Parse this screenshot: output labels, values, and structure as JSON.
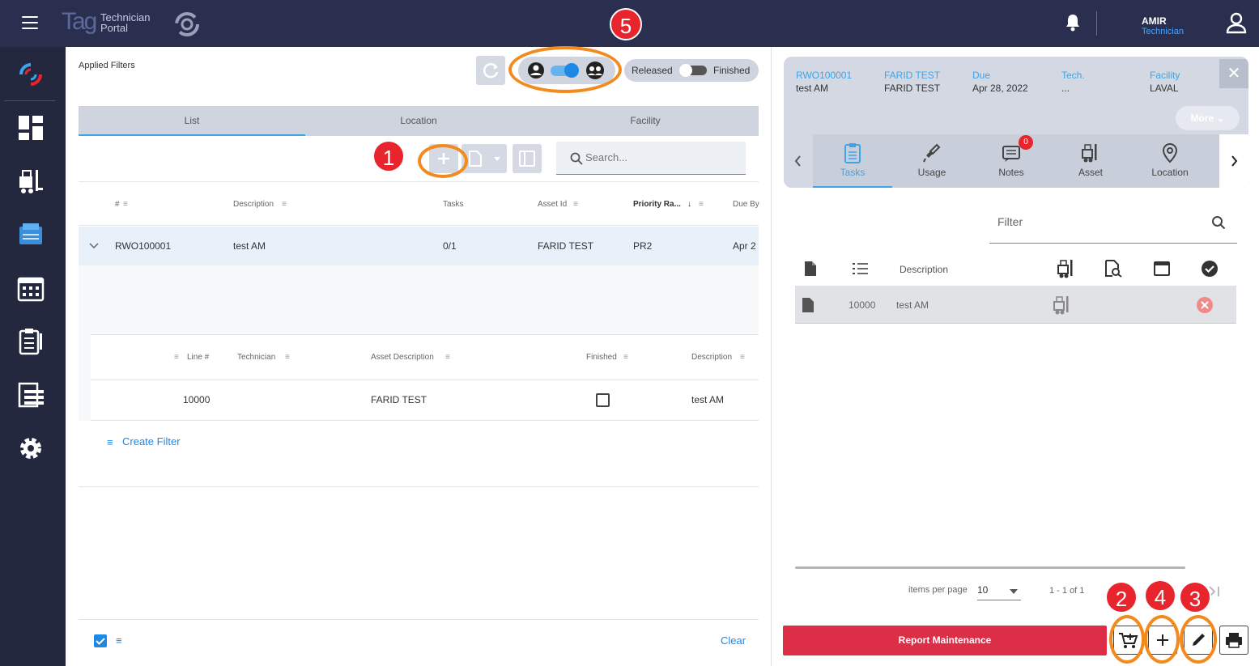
{
  "header": {
    "logo_tag": "Tag",
    "logo_sub_1": "Technician",
    "logo_sub_2": "Portal",
    "user_name": "AMIR",
    "user_role": "Technician"
  },
  "left": {
    "applied_filters": "Applied Filters",
    "released_label": "Released",
    "finished_label": "Finished",
    "tabs": [
      "List",
      "Location",
      "Facility"
    ],
    "search_placeholder": "Search...",
    "columns": {
      "num": "#",
      "description": "Description",
      "tasks": "Tasks",
      "asset_id": "Asset Id",
      "priority": "Priority Ra...",
      "due_by": "Due By"
    },
    "row": {
      "num": "RWO100001",
      "description": "test AM",
      "tasks": "0/1",
      "asset_id": "FARID TEST",
      "priority": "PR2",
      "due_by": "Apr 2"
    },
    "sub_columns": {
      "line": "Line #",
      "technician": "Technician",
      "asset_description": "Asset Description",
      "finished": "Finished",
      "description": "Description"
    },
    "sub_row": {
      "line": "10000",
      "technician": "",
      "asset_description": "FARID TEST",
      "description": "test AM"
    },
    "create_filter": "Create Filter",
    "clear": "Clear"
  },
  "right": {
    "summary": [
      {
        "label": "RWO100001",
        "value": "test AM"
      },
      {
        "label": "FARID TEST",
        "value": "FARID TEST"
      },
      {
        "label": "Due",
        "value": "Apr 28, 2022"
      },
      {
        "label": "Tech.",
        "value": "..."
      },
      {
        "label": "Facility",
        "value": "LAVAL"
      }
    ],
    "more": "More",
    "tabs": [
      {
        "label": "Tasks",
        "icon": "clipboard-icon"
      },
      {
        "label": "Usage",
        "icon": "spark-plug-icon"
      },
      {
        "label": "Notes",
        "icon": "notes-icon",
        "badge": "0"
      },
      {
        "label": "Asset",
        "icon": "forklift-icon"
      },
      {
        "label": "Location",
        "icon": "location-pin-icon"
      }
    ],
    "filter_label": "Filter",
    "task_head_description": "Description",
    "task_row": {
      "line": "10000",
      "description": "test AM"
    },
    "items_per_page_label": "items per page",
    "items_per_page": "10",
    "range": "1 - 1 of 1",
    "report_button": "Report Maintenance"
  },
  "annotations": [
    "1",
    "2",
    "3",
    "4",
    "5"
  ],
  "colors": {
    "topbar": "#2b2f4f",
    "sidebar": "#24283f",
    "accent": "#3fa3e8",
    "report": "#dc2e47",
    "annotation_ring": "#f28a1e",
    "annotation_badge": "#e8242d"
  }
}
